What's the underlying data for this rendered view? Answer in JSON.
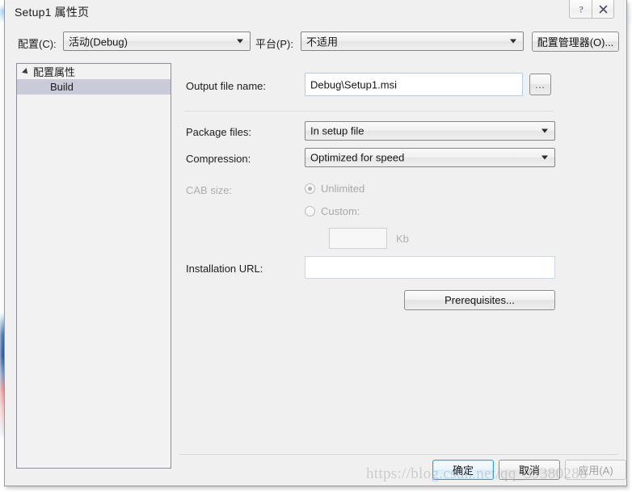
{
  "window": {
    "title": "Setup1 属性页",
    "help_button": "?",
    "close_button": "✕"
  },
  "config_bar": {
    "config_label": "配置(C):",
    "config_value": "活动(Debug)",
    "platform_label": "平台(P):",
    "platform_value": "不适用",
    "config_manager_button": "配置管理器(O)..."
  },
  "tree": {
    "root_label": "配置属性",
    "child_label": "Build"
  },
  "form": {
    "output_file_label": "Output file name:",
    "output_file_value": "Debug\\Setup1.msi",
    "browse_button": "...",
    "package_files_label": "Package files:",
    "package_files_value": "In setup file",
    "compression_label": "Compression:",
    "compression_value": "Optimized for speed",
    "cab_size_label": "CAB size:",
    "cab_unlimited_label": "Unlimited",
    "cab_custom_label": "Custom:",
    "cab_custom_value": "",
    "cab_unit_label": "Kb",
    "installation_url_label": "Installation URL:",
    "installation_url_value": "",
    "prerequisites_button": "Prerequisites..."
  },
  "footer": {
    "ok_button": "确定",
    "cancel_button": "取消",
    "apply_button": "应用(A)"
  },
  "watermark": {
    "text": "https://blog.csdn.net/qq_39380288"
  },
  "colors": {
    "dialog_background": "#f0f0f0",
    "selection": "#c9cbd9",
    "default_button_border": "#2e9fe0",
    "disabled_text": "#a9a9a9"
  }
}
